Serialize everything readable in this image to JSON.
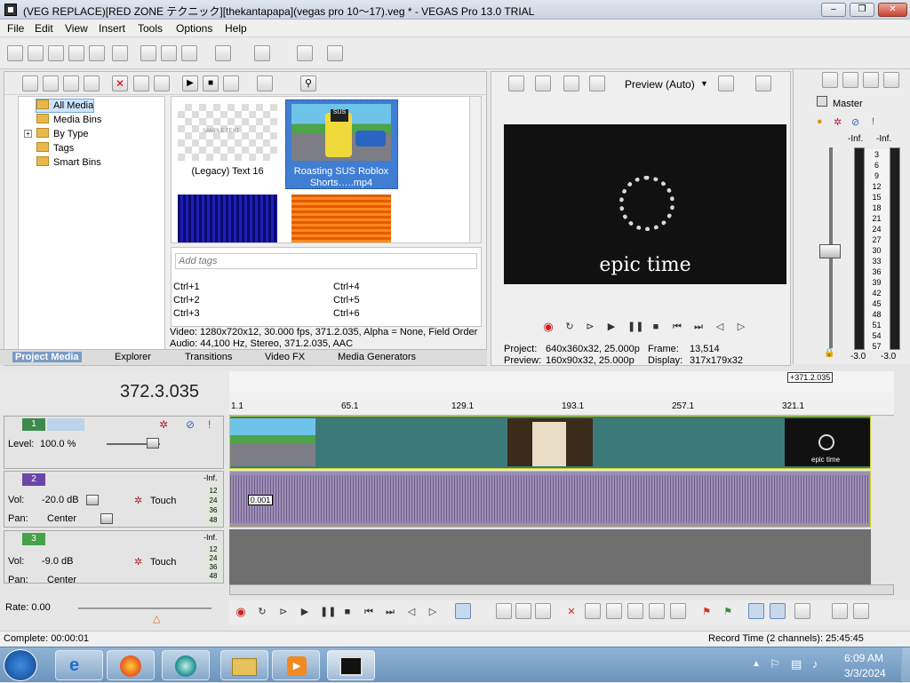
{
  "window": {
    "title": "(VEG REPLACE)[RED ZONE テクニック][thekantapapa](vegas pro 10～17).veg * - VEGAS Pro 13.0 TRIAL",
    "controls": [
      "–",
      "❐",
      "✕"
    ]
  },
  "menu": {
    "items": [
      "File",
      "Edit",
      "View",
      "Insert",
      "Tools",
      "Options",
      "Help"
    ]
  },
  "media_panel": {
    "tree": [
      {
        "label": "All Media",
        "selected": true
      },
      {
        "label": "Media Bins"
      },
      {
        "label": "By Type"
      },
      {
        "label": "Tags"
      },
      {
        "label": "Smart Bins"
      }
    ],
    "thumbs": [
      {
        "label": "(Legacy) Text 16"
      },
      {
        "label": "Roasting SUS Roblox Shorts…..mp4"
      }
    ],
    "thumb_overlay_text": "SAMPLE TEXT",
    "thumb_sus_text": "SUS",
    "tags_placeholder": "Add tags",
    "shortcuts": [
      "Ctrl+1",
      "Ctrl+2",
      "Ctrl+3",
      "Ctrl+4",
      "Ctrl+5",
      "Ctrl+6"
    ],
    "info_line1": "Video: 1280x720x12, 30.000 fps, 371.2.035, Alpha = None, Field Order",
    "info_line2": "Audio: 44,100 Hz, Stereo, 371.2.035, AAC"
  },
  "tabs": [
    "Project Media",
    "Explorer",
    "Transitions",
    "Video FX",
    "Media Generators"
  ],
  "preview": {
    "mode_label": "Preview (Auto)",
    "overlay_text": "epic time",
    "project_label": "Project:",
    "project_value": "640x360x32, 25.000p",
    "preview_label": "Preview:",
    "preview_value": "160x90x32, 25.000p",
    "frame_label": "Frame:",
    "frame_value": "13,514",
    "display_label": "Display:",
    "display_value": "317x179x32"
  },
  "master": {
    "label": "Master",
    "inf_left": "-Inf.",
    "inf_right": "-Inf.",
    "scale": [
      "3",
      "6",
      "9",
      "12",
      "15",
      "18",
      "21",
      "24",
      "27",
      "30",
      "33",
      "36",
      "39",
      "42",
      "45",
      "48",
      "51",
      "54",
      "57"
    ],
    "bottom_left": "-3.0",
    "bottom_right": "-3.0"
  },
  "timeline": {
    "timecode": "372.3.035",
    "end_marker": "+371.2.035",
    "ruler": [
      "1.1",
      "65.1",
      "129.1",
      "193.1",
      "257.1",
      "321.1"
    ],
    "video_track": {
      "num": "1",
      "level_label": "Level:",
      "level_value": "100.0 %"
    },
    "audio_track": {
      "num": "2",
      "vol_label": "Vol:",
      "vol_value": "-20.0 dB",
      "pan_label": "Pan:",
      "pan_value": "Center",
      "touch": "Touch",
      "inf": "-Inf.",
      "scale": [
        "12",
        "24",
        "36",
        "48"
      ],
      "fade_value": "0.001"
    },
    "audio_track3": {
      "num": "3",
      "vol_label": "Vol:",
      "vol_value": "-9.0 dB",
      "pan_label": "Pan:",
      "pan_value": "Center",
      "touch": "Touch",
      "inf": "-Inf.",
      "scale": [
        "12",
        "24",
        "36",
        "48"
      ]
    },
    "clip_text": "epic time",
    "rate_label": "Rate: 0.00"
  },
  "status": {
    "left": "Complete: 00:00:01",
    "right": "Record Time (2 channels): 25:45:45"
  },
  "taskbar": {
    "time": "6:09 AM",
    "date": "3/3/2024",
    "apps": [
      "windows-start",
      "internet-explorer",
      "firefox",
      "app-globe",
      "file-explorer",
      "media-player",
      "vegas-pro"
    ]
  },
  "colors": {
    "video_track": "#3b7a79",
    "audio_track": "#9d8fb6",
    "track_border": "#c7d12e",
    "track1_color": "#3e8a4d",
    "track2_color": "#6a46a8",
    "track3_color": "#45a24a"
  }
}
